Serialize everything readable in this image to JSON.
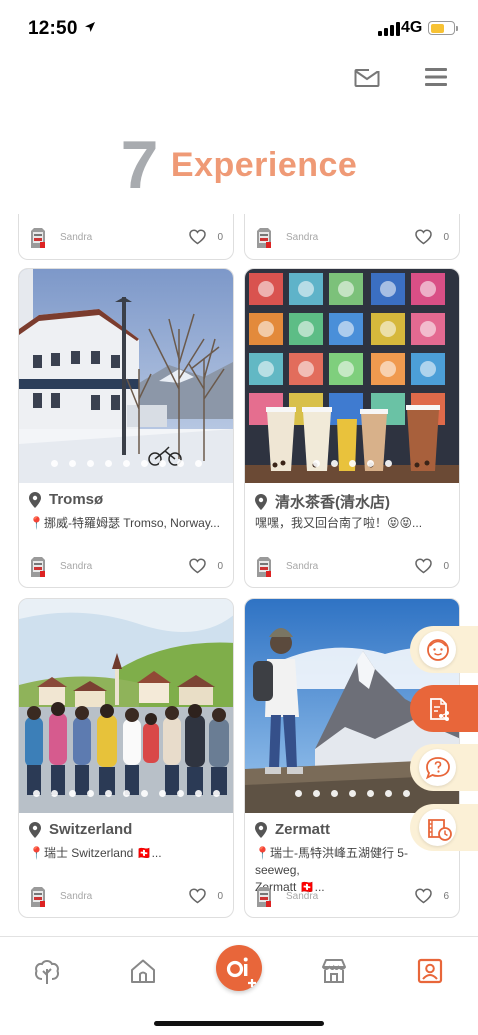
{
  "status_bar": {
    "time": "12:50",
    "network": "4G"
  },
  "header": {
    "big_number": "7",
    "title": "Experience"
  },
  "cards": [
    {
      "user": "Sandra",
      "likes": "0"
    },
    {
      "user": "Sandra",
      "likes": "0"
    },
    {
      "title": "Tromsø",
      "desc": "📍挪威-特羅姆瑟 Tromso, Norway...",
      "user": "Sandra",
      "likes": "0",
      "dots": 9,
      "image": "tromso-street-photo"
    },
    {
      "title": "清水茶香(清水店)",
      "desc": "嘿嘿，我又回台南了啦！😝😝...",
      "user": "Sandra",
      "likes": "0",
      "dots": 5,
      "image": "bubble-tea-tiles-photo"
    },
    {
      "title": "Switzerland",
      "desc": "📍瑞士 Switzerland 🇨🇭...",
      "user": "Sandra",
      "likes": "0",
      "dots": 11,
      "image": "swiss-village-group-photo"
    },
    {
      "title": "Zermatt",
      "desc": "📍瑞士-馬特洪峰五湖健行 5-seeweg,\nZermatt 🇨🇭...",
      "user": "Sandra",
      "likes": "6",
      "dots": 7,
      "image": "matterhorn-hiker-photo"
    }
  ],
  "side_actions": [
    "face-icon",
    "share-document-icon",
    "chat-question-icon",
    "ticket-clock-icon"
  ],
  "bottom_nav": [
    "tree-icon",
    "home-icon",
    "oi-add-button",
    "store-icon",
    "profile-icon"
  ],
  "colors": {
    "accent": "#e8663a",
    "title": "#ef9a76",
    "number": "#a8abaf",
    "fab_bg": "#fbf0d6"
  }
}
